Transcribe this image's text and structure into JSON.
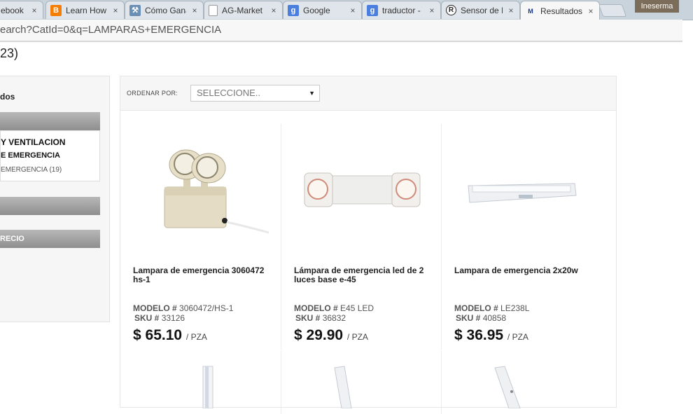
{
  "browser": {
    "tabs": [
      {
        "title": "ebook",
        "icon": "facebook-icon"
      },
      {
        "title": "Learn How",
        "icon": "blogger-icon"
      },
      {
        "title": "Cómo Gana",
        "icon": "tool-icon"
      },
      {
        "title": "AG-Market",
        "icon": "document-icon"
      },
      {
        "title": "Google",
        "icon": "google-icon"
      },
      {
        "title": "traductor -",
        "icon": "google-icon"
      },
      {
        "title": "Sensor de I",
        "icon": "registered-icon"
      },
      {
        "title": "Resultados",
        "icon": "site-icon"
      }
    ],
    "close_glyph": "×",
    "profile_name": "Ineserma",
    "url": "earch?CatId=0&q=LAMPARAS+EMERGENCIA"
  },
  "page": {
    "result_count": "23)"
  },
  "sidebar": {
    "label": "dos",
    "bar1": "",
    "categories": [
      {
        "text": "Y VENTILACION",
        "bold": true
      },
      {
        "text": "E EMERGENCIA",
        "bold": true
      },
      {
        "text": " EMERGENCIA (19)",
        "bold": false
      }
    ],
    "bar2": "",
    "bar3": "RECIO"
  },
  "sort": {
    "label": "ORDENAR POR:",
    "selected": "SELECCIONE..",
    "arrow": "▼"
  },
  "products": [
    {
      "name": "Lampara de emergencia 3060472 hs-1",
      "model_label": "MODELO #",
      "model": "3060472/HS-1",
      "sku_label": "SKU #",
      "sku": "33126",
      "price": "$ 65.10",
      "unit": "/ PZA",
      "image": "twin-spot-emergency-light"
    },
    {
      "name": "Lámpara de emergencia led de 2 luces base e-45",
      "model_label": "MODELO #",
      "model": "E45 LED",
      "sku_label": "SKU #",
      "sku": "36832",
      "price": "$ 29.90",
      "unit": "/ PZA",
      "image": "led-twin-emergency-light"
    },
    {
      "name": "Lampara de emergencia 2x20w",
      "model_label": "MODELO #",
      "model": "LE238L",
      "sku_label": "SKU #",
      "sku": "40858",
      "price": "$ 36.95",
      "unit": "/ PZA",
      "image": "fluorescent-emergency-light"
    }
  ],
  "colors": {
    "accent_bar": "#9a9a9a",
    "price": "#111111"
  }
}
